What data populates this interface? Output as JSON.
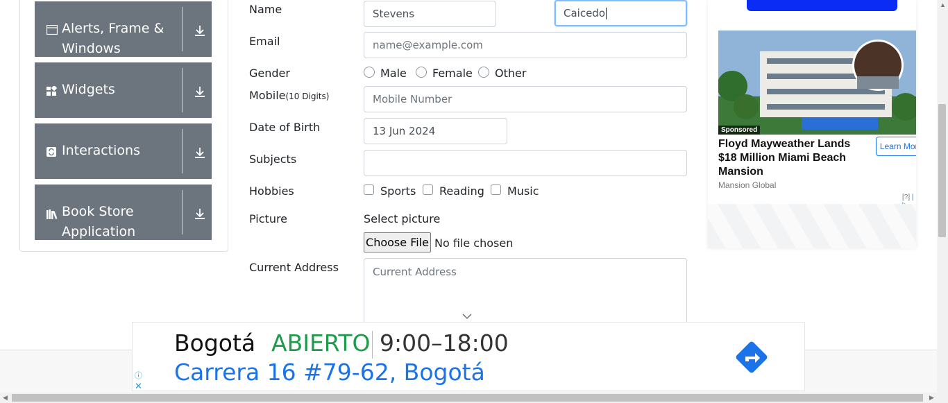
{
  "sidebar": {
    "groups": [
      {
        "label": "Alerts, Frame & Windows",
        "icon": "window-icon"
      },
      {
        "label": "Widgets",
        "icon": "widgets-icon"
      },
      {
        "label": "Interactions",
        "icon": "interactions-icon"
      },
      {
        "label": "Book Store Application",
        "icon": "books-icon"
      }
    ]
  },
  "form": {
    "name_label": "Name",
    "first_name": "Stevens",
    "last_name": "Caicedo",
    "email_label": "Email",
    "email_placeholder": "name@example.com",
    "gender_label": "Gender",
    "gender_options": [
      "Male",
      "Female",
      "Other"
    ],
    "mobile_label": "Mobile",
    "mobile_hint": "(10 Digits)",
    "mobile_placeholder": "Mobile Number",
    "dob_label": "Date of Birth",
    "dob_value": "13 Jun 2024",
    "subjects_label": "Subjects",
    "hobbies_label": "Hobbies",
    "hobbies_options": [
      "Sports",
      "Reading",
      "Music"
    ],
    "picture_label": "Picture",
    "select_picture": "Select picture",
    "choose_file": "Choose File",
    "no_file": "No file chosen",
    "address_label": "Current Address",
    "address_placeholder": "Current Address"
  },
  "ad_right": {
    "sponsored": "Sponsored",
    "title": "Floyd Mayweather Lands $18 Million Miami Beach Mansion",
    "cta": "Learn More",
    "source": "Mansion Global",
    "info": "[?]",
    "close": "✕"
  },
  "banner": {
    "city": "Bogotá",
    "status": "ABIERTO",
    "hours": "9:00–18:00",
    "address": "Carrera 16 #79-62, Bogotá",
    "info": "ⓘ",
    "close": "✕"
  },
  "colors": {
    "sidebar_bg": "#6c757d",
    "focus_border": "#80bdff",
    "open_green": "#1e9b4a",
    "link_blue": "#1a73e8"
  }
}
